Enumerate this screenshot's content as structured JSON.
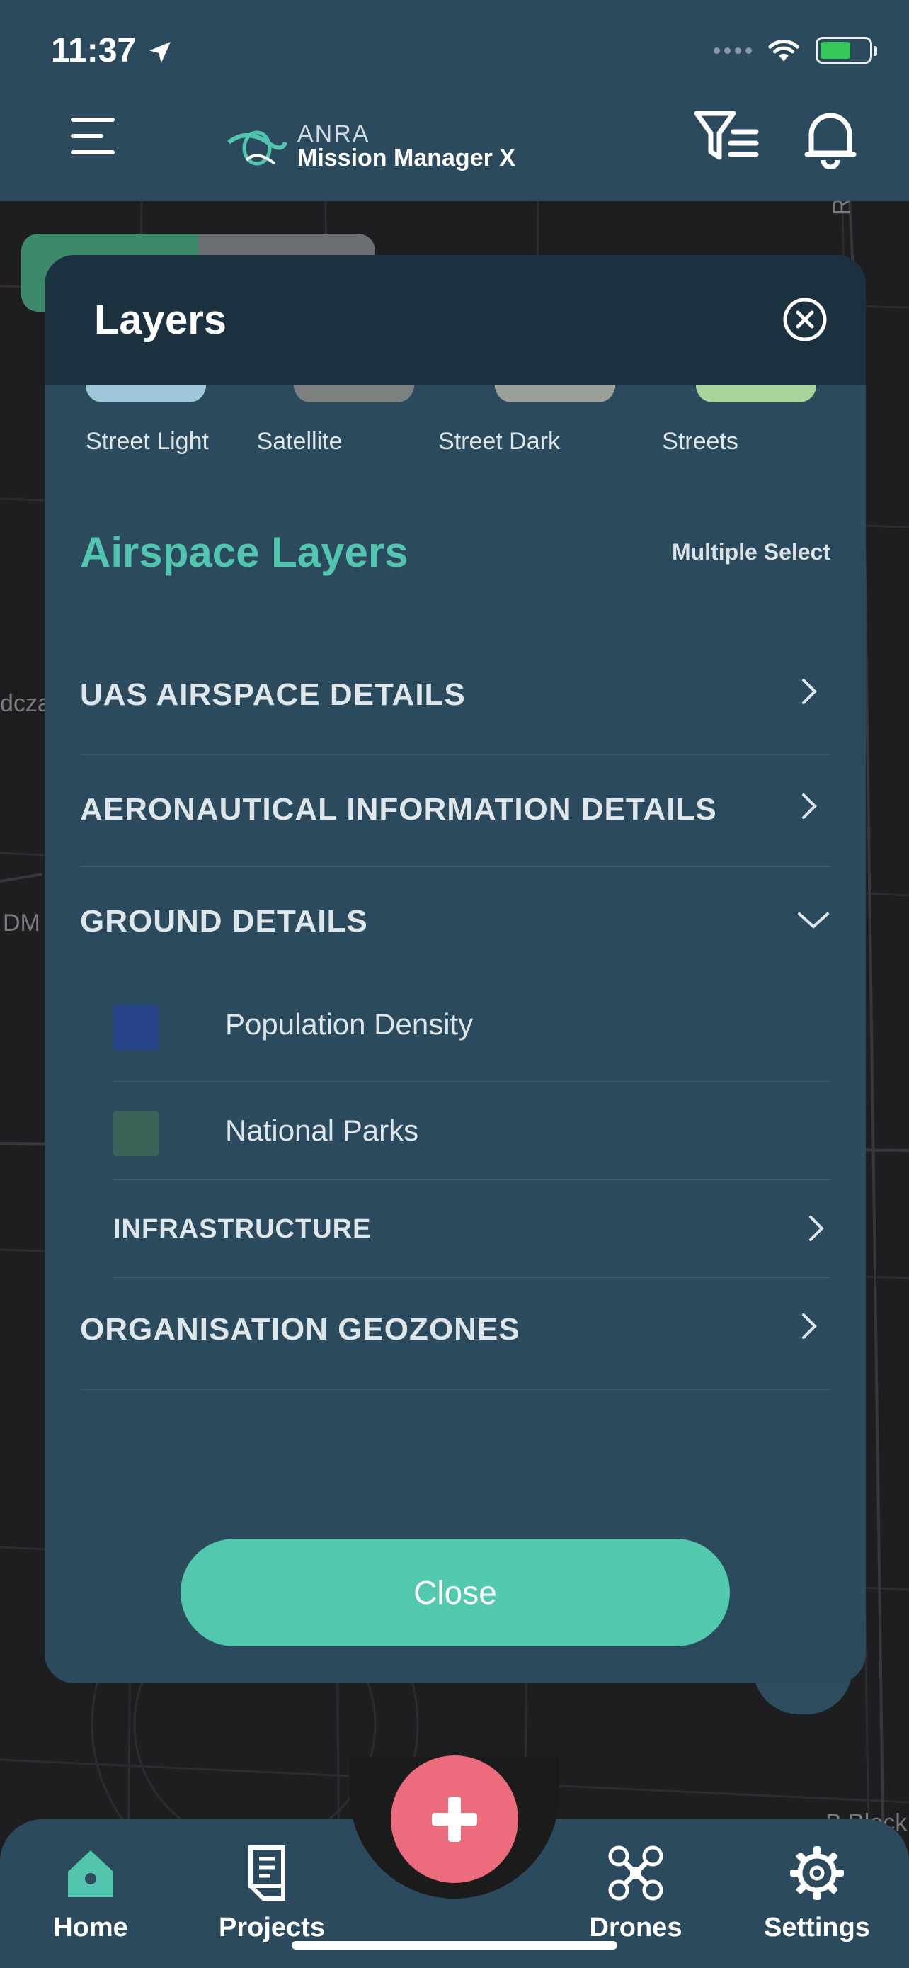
{
  "status_bar": {
    "time": "11:37"
  },
  "header": {
    "logo_top": "ANRA",
    "logo_bottom": "Mission Manager X"
  },
  "map": {
    "label_left": "dcza",
    "label_dm": "DM",
    "label_road": "Road",
    "label_b": "B Block"
  },
  "modal": {
    "title": "Layers",
    "map_styles": [
      "Street Light",
      "Satellite",
      "Street Dark",
      "Streets"
    ],
    "section_title": "Airspace Layers",
    "multiple_select": "Multiple Select",
    "rows": [
      "UAS AIRSPACE DETAILS",
      "AERONAUTICAL INFORMATION DETAILS",
      "GROUND DETAILS",
      "ORGANISATION GEOZONES"
    ],
    "ground_items": [
      {
        "label": "Population Density",
        "color": "#27438a"
      },
      {
        "label": "National Parks",
        "color": "#3b6358"
      }
    ],
    "infrastructure": "INFRASTRUCTURE",
    "close_label": "Close"
  },
  "tabs": [
    "Home",
    "Projects",
    "Drones",
    "Settings"
  ],
  "colors": {
    "accent": "#52c5ae",
    "panel": "#2b4a5e",
    "fab": "#ec6b7d"
  }
}
